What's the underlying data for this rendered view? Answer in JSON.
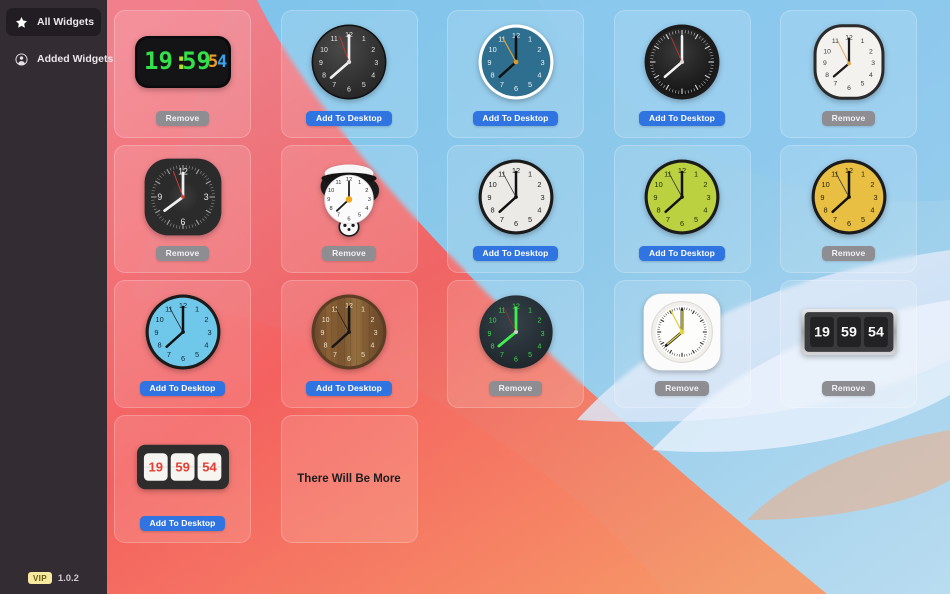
{
  "app": {
    "version": "1.0.2",
    "vip_badge": "VIP"
  },
  "sidebar": {
    "items": [
      {
        "label": "All Widgets",
        "icon": "star-icon",
        "active": true
      },
      {
        "label": "Added Widgets",
        "icon": "user-circle-icon",
        "active": false
      }
    ]
  },
  "buttons": {
    "add": "Add To Desktop",
    "remove": "Remove"
  },
  "time": {
    "hours": "19",
    "minutes": "59",
    "seconds": "54",
    "digital_display": "19:59:54"
  },
  "colors": {
    "accent_blue": "#2f74e0",
    "remove_gray": "#8d8d92",
    "vip_yellow": "#f7e9a0",
    "sidebar_bg": "#332c33"
  },
  "placeholder": {
    "text": "There Will Be More"
  },
  "widgets": [
    {
      "name": "led-digital-clock",
      "type": "digital-led",
      "action": "remove",
      "display": "19:59:54"
    },
    {
      "name": "dark-round-clock",
      "type": "analog",
      "action": "add"
    },
    {
      "name": "teal-round-clock",
      "type": "analog",
      "action": "add"
    },
    {
      "name": "black-ticks-clock",
      "type": "analog",
      "action": "add"
    },
    {
      "name": "white-squircle-clock",
      "type": "analog",
      "action": "remove"
    },
    {
      "name": "dark-squircle-clock",
      "type": "analog",
      "action": "remove"
    },
    {
      "name": "panda-clock",
      "type": "analog",
      "action": "remove"
    },
    {
      "name": "classic-white-clock",
      "type": "analog",
      "action": "add"
    },
    {
      "name": "olive-green-clock",
      "type": "analog",
      "action": "add"
    },
    {
      "name": "golden-yellow-clock",
      "type": "analog",
      "action": "remove"
    },
    {
      "name": "sky-blue-clock",
      "type": "analog",
      "action": "add"
    },
    {
      "name": "wooden-clock",
      "type": "analog",
      "action": "add"
    },
    {
      "name": "neon-green-clock",
      "type": "analog",
      "action": "remove"
    },
    {
      "name": "white-frame-gold-clock",
      "type": "analog",
      "action": "remove"
    },
    {
      "name": "silver-flip-clock",
      "type": "flip-dark",
      "action": "remove"
    },
    {
      "name": "red-flip-clock",
      "type": "flip-light",
      "action": "add"
    },
    {
      "name": "coming-soon-placeholder",
      "type": "placeholder",
      "action": "none"
    }
  ]
}
